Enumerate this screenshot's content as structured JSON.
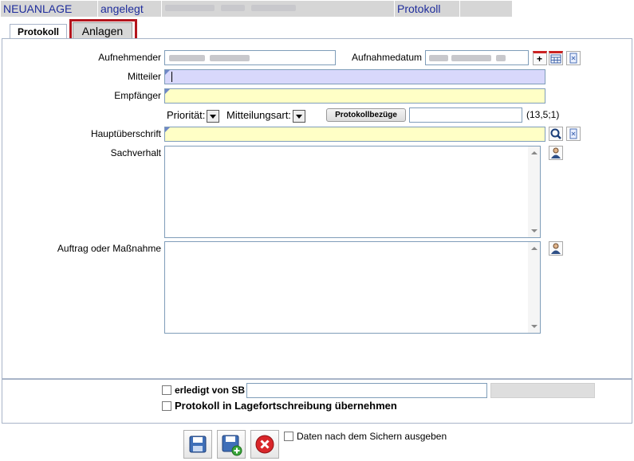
{
  "header": {
    "status1": "NEUANLAGE",
    "status2": "angelegt",
    "status3": "",
    "section": "Protokoll"
  },
  "tabs": [
    {
      "label": "Protokoll",
      "active": true
    },
    {
      "label": "Anlagen",
      "active": false
    }
  ],
  "form": {
    "aufnehmender_label": "Aufnehmender",
    "aufnahmedatum_label": "Aufnahmedatum",
    "mitteiler_label": "Mitteiler",
    "empfaenger_label": "Empfänger",
    "prioritaet_label": "Priorität:",
    "mitteilungsart_label": "Mitteilungsart:",
    "protokollbezuege_button": "Protokollbezüge",
    "count_text": "(13,5;1)",
    "hauptueberschrift_label": "Hauptüberschrift",
    "sachverhalt_label": "Sachverhalt",
    "auftrag_label": "Auftrag oder Maßnahme"
  },
  "footer_form": {
    "erledigt_label": "erledigt von SB",
    "lage_label": "Protokoll in Lagefortschreibung übernehmen"
  },
  "actions": {
    "output_label": "Daten nach dem Sichern ausgeben"
  },
  "colors": {
    "header_text": "#1f2d9c",
    "highlight": "#b3151d",
    "mitteiler_bg": "#d8d8fb",
    "yellow_bg": "#ffffc6"
  }
}
